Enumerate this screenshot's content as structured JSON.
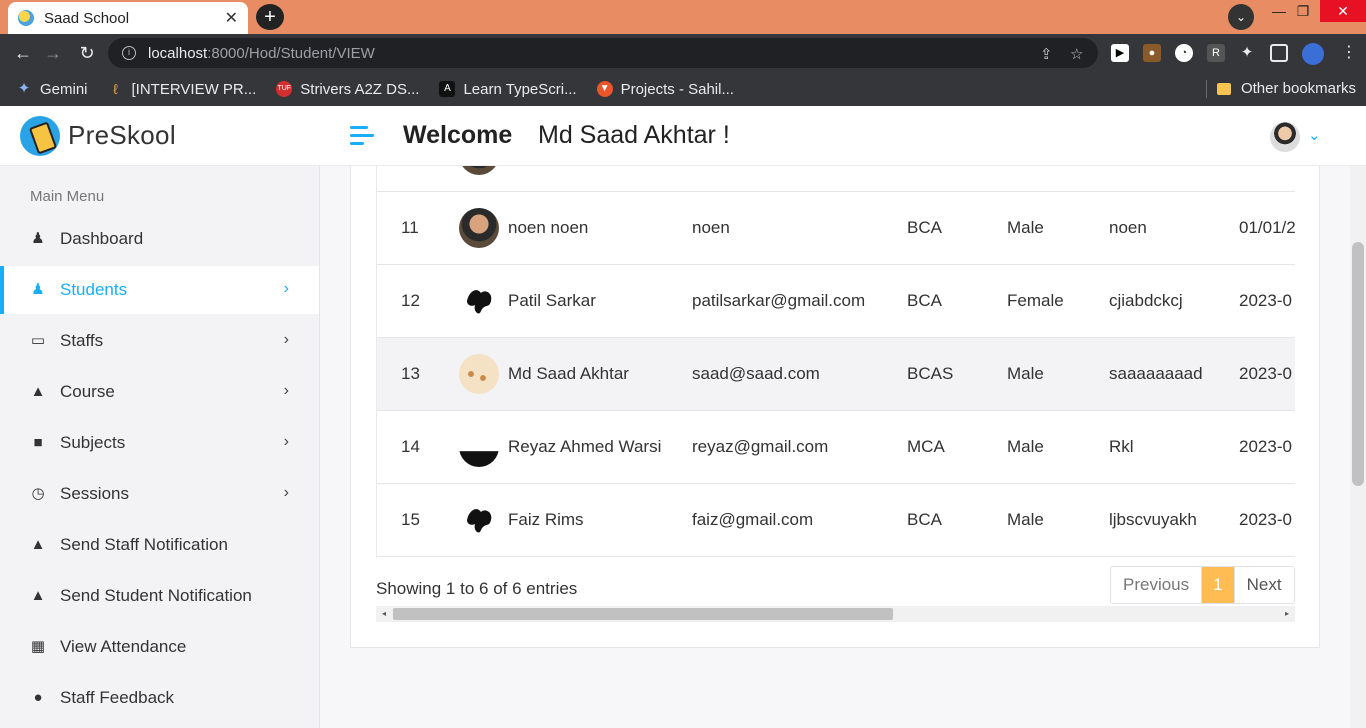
{
  "browser": {
    "tab_title": "Saad School",
    "url_host": "localhost",
    "url_path": ":8000/Hod/Student/VIEW",
    "bookmarks": [
      "Gemini",
      "[INTERVIEW PR...",
      "Strivers A2Z DS...",
      "Learn TypeScri...",
      "Projects - Sahil..."
    ],
    "other_bookmarks": "Other bookmarks"
  },
  "brand": {
    "name": "PreSkool"
  },
  "sidebar": {
    "heading": "Main Menu",
    "items": [
      {
        "label": "Dashboard",
        "icon": "dashboard-icon"
      },
      {
        "label": "Students",
        "icon": "student-icon",
        "active": true
      },
      {
        "label": "Staffs",
        "icon": "staff-icon"
      },
      {
        "label": "Course",
        "icon": "course-icon"
      },
      {
        "label": "Subjects",
        "icon": "subjects-icon"
      },
      {
        "label": "Sessions",
        "icon": "clock-icon"
      },
      {
        "label": "Send Staff Notification",
        "icon": "bell-icon"
      },
      {
        "label": "Send Student Notification",
        "icon": "bell-icon"
      },
      {
        "label": "View Attendance",
        "icon": "calendar-icon"
      },
      {
        "label": "Staff Feedback",
        "icon": "comments-icon"
      }
    ]
  },
  "header": {
    "welcome": "Welcome",
    "user_name": "Md Saad Akhtar !"
  },
  "table": {
    "rows": [
      {
        "id": "11",
        "name": "noen noen",
        "email": "noen",
        "course": "BCA",
        "gender": "Male",
        "address": "noen",
        "date": "01/01/2"
      },
      {
        "id": "12",
        "name": "Patil Sarkar",
        "email": "patilsarkar@gmail.com",
        "course": "BCA",
        "gender": "Female",
        "address": "cjiabdckcj",
        "date": "2023-0"
      },
      {
        "id": "13",
        "name": "Md Saad Akhtar",
        "email": "saad@saad.com",
        "course": "BCAS",
        "gender": "Male",
        "address": "saaaaaaaad",
        "date": "2023-0"
      },
      {
        "id": "14",
        "name": "Reyaz Ahmed Warsi",
        "email": "reyaz@gmail.com",
        "course": "MCA",
        "gender": "Male",
        "address": "Rkl",
        "date": "2023-0"
      },
      {
        "id": "15",
        "name": "Faiz Rims",
        "email": "faiz@gmail.com",
        "course": "BCA",
        "gender": "Male",
        "address": "ljbscvuyakh",
        "date": "2023-0"
      }
    ],
    "entries_text": "Showing 1 to 6 of 6 entries",
    "pagination": {
      "previous": "Previous",
      "current": "1",
      "next": "Next"
    }
  },
  "colors": {
    "accent": "#18aefa",
    "page_active": "#ffbc53"
  }
}
